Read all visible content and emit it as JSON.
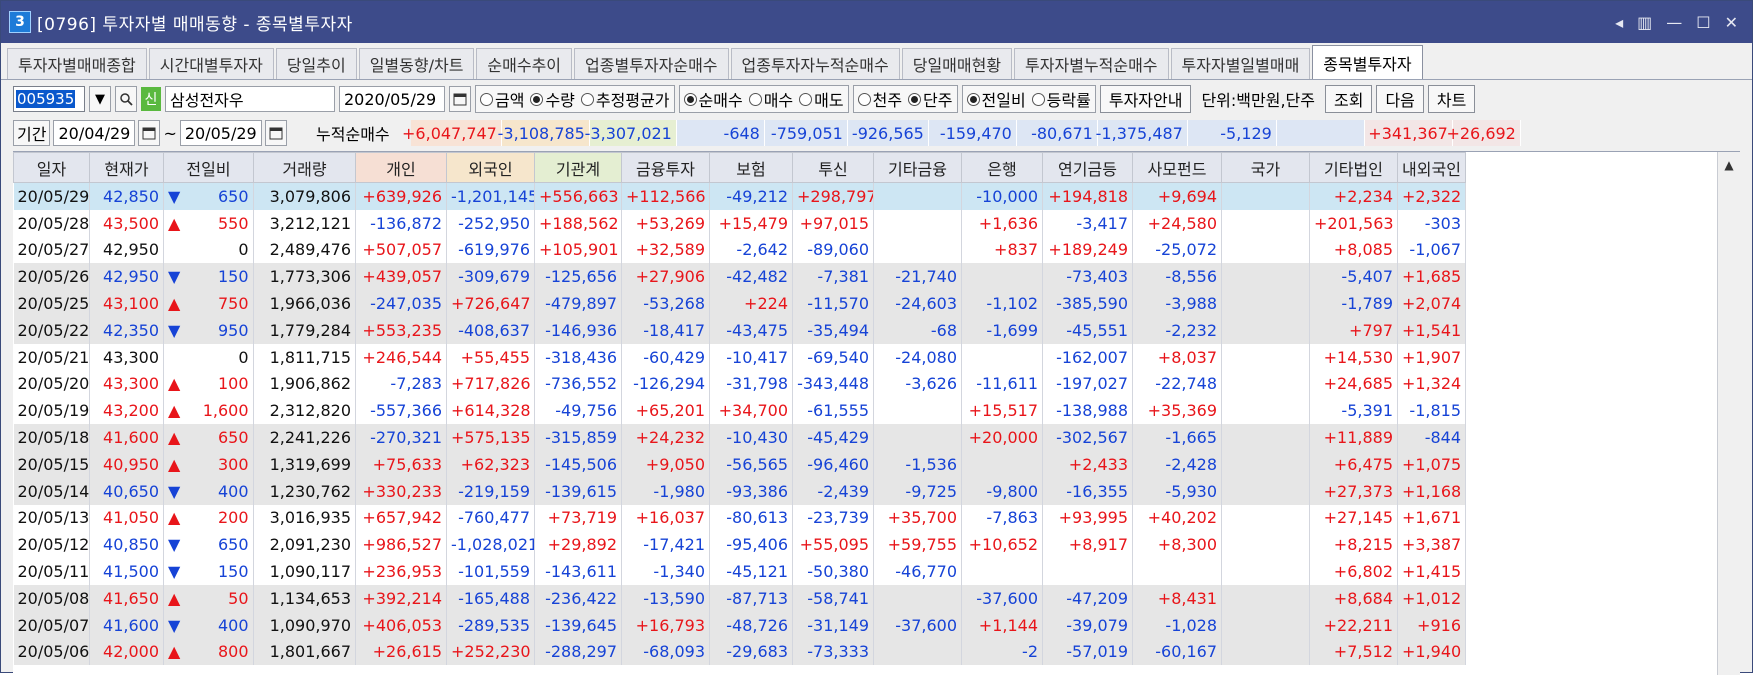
{
  "window": {
    "number": "3",
    "title": "[0796] 투자자별 매매동향 - 종목별투자자",
    "controls": [
      "◂",
      "▥",
      "—",
      "☐",
      "✕"
    ]
  },
  "tabs": [
    {
      "label": "투자자별매매종합",
      "active": false
    },
    {
      "label": "시간대별투자자",
      "active": false
    },
    {
      "label": "당일추이",
      "active": false
    },
    {
      "label": "일별동향/차트",
      "active": false
    },
    {
      "label": "순매수추이",
      "active": false
    },
    {
      "label": "업종별투자자순매수",
      "active": false
    },
    {
      "label": "업종투자자누적순매수",
      "active": false
    },
    {
      "label": "당일매매현황",
      "active": false
    },
    {
      "label": "투자자별누적순매수",
      "active": false
    },
    {
      "label": "투자자별일별매매",
      "active": false
    },
    {
      "label": "종목별투자자",
      "active": true
    }
  ],
  "toolbar": {
    "code": "005935",
    "sin_badge": "신",
    "stock_name": "삼성전자우",
    "date": "2020/05/29",
    "radio_group1": [
      {
        "label": "금액",
        "on": false
      },
      {
        "label": "수량",
        "on": true
      },
      {
        "label": "추정평균가",
        "on": false
      }
    ],
    "radio_group2": [
      {
        "label": "순매수",
        "on": true
      },
      {
        "label": "매수",
        "on": false
      },
      {
        "label": "매도",
        "on": false
      }
    ],
    "radio_group3": [
      {
        "label": "천주",
        "on": false
      },
      {
        "label": "단주",
        "on": true
      }
    ],
    "radio_group4": [
      {
        "label": "전일비",
        "on": true
      },
      {
        "label": "등락률",
        "on": false
      }
    ],
    "guide_button": "투자자안내",
    "unit_text": "단위:백만원,단주",
    "query_button": "조회",
    "next_button": "다음",
    "chart_button": "차트"
  },
  "period": {
    "label": "기간",
    "from": "20/04/29",
    "tilde": "~",
    "to": "20/05/29",
    "cum_label": "누적순매수",
    "sums": [
      {
        "v": "+6,047,747",
        "cls": "red",
        "bg": "#f8e3d6"
      },
      {
        "v": "-3,108,785",
        "cls": "blue",
        "bg": "#f6e6cc"
      },
      {
        "v": "-3,307,021",
        "cls": "blue",
        "bg": "#e6efd2"
      },
      {
        "v": "-648",
        "cls": "blue",
        "bg": "#dde6f4"
      },
      {
        "v": "-759,051",
        "cls": "blue",
        "bg": "#dde6f4"
      },
      {
        "v": "-926,565",
        "cls": "blue",
        "bg": "#dde6f4"
      },
      {
        "v": "-159,470",
        "cls": "blue",
        "bg": "#dde6f4"
      },
      {
        "v": "-80,671",
        "cls": "blue",
        "bg": "#dde6f4"
      },
      {
        "v": "-1,375,487",
        "cls": "blue",
        "bg": "#dde6f4"
      },
      {
        "v": "-5,129",
        "cls": "blue",
        "bg": "#dde6f4"
      },
      {
        "v": "",
        "cls": "blue",
        "bg": "#dde6f4"
      },
      {
        "v": "+341,367",
        "cls": "red",
        "bg": "#f3e6e6"
      },
      {
        "v": "+26,692",
        "cls": "red",
        "bg": "#f3e6e6"
      }
    ]
  },
  "columns": [
    "일자",
    "현재가",
    "전일비",
    "거래량",
    "개인",
    "외국인",
    "기관계",
    "금융투자",
    "보험",
    "투신",
    "기타금융",
    "은행",
    "연기금등",
    "사모펀드",
    "국가",
    "기타법인",
    "내외국인"
  ],
  "header_colors": {
    "개인": "#f6dfd4",
    "외국인": "#f6e6cc",
    "기관계": "#e4eed2"
  },
  "rows": [
    {
      "bg": "sel",
      "cells": [
        "20/05/29",
        "42,850",
        "dn|650",
        "3,079,806",
        "+639,926",
        "-1,201,145",
        "+556,663",
        "+112,566",
        "-49,212",
        "+298,797",
        "",
        "-10,000",
        "+194,818",
        "+9,694",
        "",
        "+2,234",
        "+2,322"
      ]
    },
    {
      "bg": "",
      "cells": [
        "20/05/28",
        "43,500",
        "up|550",
        "3,212,121",
        "-136,872",
        "-252,950",
        "+188,562",
        "+53,269",
        "+15,479",
        "+97,015",
        "",
        "+1,636",
        "-3,417",
        "+24,580",
        "",
        "+201,563",
        "-303"
      ]
    },
    {
      "bg": "",
      "cells": [
        "20/05/27",
        "42,950",
        "|0",
        "2,489,476",
        "+507,057",
        "-619,976",
        "+105,901",
        "+32,589",
        "-2,642",
        "-89,060",
        "",
        "+837",
        "+189,249",
        "-25,072",
        "",
        "+8,085",
        "-1,067"
      ]
    },
    {
      "bg": "g",
      "cells": [
        "20/05/26",
        "42,950",
        "dn|150",
        "1,773,306",
        "+439,057",
        "-309,679",
        "-125,656",
        "+27,906",
        "-42,482",
        "-7,381",
        "-21,740",
        "",
        "-73,403",
        "-8,556",
        "",
        "-5,407",
        "+1,685"
      ]
    },
    {
      "bg": "g",
      "cells": [
        "20/05/25",
        "43,100",
        "up|750",
        "1,966,036",
        "-247,035",
        "+726,647",
        "-479,897",
        "-53,268",
        "+224",
        "-11,570",
        "-24,603",
        "-1,102",
        "-385,590",
        "-3,988",
        "",
        "-1,789",
        "+2,074"
      ]
    },
    {
      "bg": "g",
      "cells": [
        "20/05/22",
        "42,350",
        "dn|950",
        "1,779,284",
        "+553,235",
        "-408,637",
        "-146,936",
        "-18,417",
        "-43,475",
        "-35,494",
        "-68",
        "-1,699",
        "-45,551",
        "-2,232",
        "",
        "+797",
        "+1,541"
      ]
    },
    {
      "bg": "",
      "cells": [
        "20/05/21",
        "43,300",
        "|0",
        "1,811,715",
        "+246,544",
        "+55,455",
        "-318,436",
        "-60,429",
        "-10,417",
        "-69,540",
        "-24,080",
        "",
        "-162,007",
        "+8,037",
        "",
        "+14,530",
        "+1,907"
      ]
    },
    {
      "bg": "",
      "cells": [
        "20/05/20",
        "43,300",
        "up|100",
        "1,906,862",
        "-7,283",
        "+717,826",
        "-736,552",
        "-126,294",
        "-31,798",
        "-343,448",
        "-3,626",
        "-11,611",
        "-197,027",
        "-22,748",
        "",
        "+24,685",
        "+1,324"
      ]
    },
    {
      "bg": "",
      "cells": [
        "20/05/19",
        "43,200",
        "up|1,600",
        "2,312,820",
        "-557,366",
        "+614,328",
        "-49,756",
        "+65,201",
        "+34,700",
        "-61,555",
        "",
        "+15,517",
        "-138,988",
        "+35,369",
        "",
        "-5,391",
        "-1,815"
      ]
    },
    {
      "bg": "g",
      "cells": [
        "20/05/18",
        "41,600",
        "up|650",
        "2,241,226",
        "-270,321",
        "+575,135",
        "-315,859",
        "+24,232",
        "-10,430",
        "-45,429",
        "",
        "+20,000",
        "-302,567",
        "-1,665",
        "",
        "+11,889",
        "-844"
      ]
    },
    {
      "bg": "g",
      "cells": [
        "20/05/15",
        "40,950",
        "up|300",
        "1,319,699",
        "+75,633",
        "+62,323",
        "-145,506",
        "+9,050",
        "-56,565",
        "-96,460",
        "-1,536",
        "",
        "+2,433",
        "-2,428",
        "",
        "+6,475",
        "+1,075"
      ]
    },
    {
      "bg": "g",
      "cells": [
        "20/05/14",
        "40,650",
        "dn|400",
        "1,230,762",
        "+330,233",
        "-219,159",
        "-139,615",
        "-1,980",
        "-93,386",
        "-2,439",
        "-9,725",
        "-9,800",
        "-16,355",
        "-5,930",
        "",
        "+27,373",
        "+1,168"
      ]
    },
    {
      "bg": "",
      "cells": [
        "20/05/13",
        "41,050",
        "up|200",
        "3,016,935",
        "+657,942",
        "-760,477",
        "+73,719",
        "+16,037",
        "-80,613",
        "-23,739",
        "+35,700",
        "-7,863",
        "+93,995",
        "+40,202",
        "",
        "+27,145",
        "+1,671"
      ]
    },
    {
      "bg": "",
      "cells": [
        "20/05/12",
        "40,850",
        "dn|650",
        "2,091,230",
        "+986,527",
        "-1,028,021",
        "+29,892",
        "-17,421",
        "-95,406",
        "+55,095",
        "+59,755",
        "+10,652",
        "+8,917",
        "+8,300",
        "",
        "+8,215",
        "+3,387"
      ]
    },
    {
      "bg": "",
      "cells": [
        "20/05/11",
        "41,500",
        "dn|150",
        "1,090,117",
        "+236,953",
        "-101,559",
        "-143,611",
        "-1,340",
        "-45,121",
        "-50,380",
        "-46,770",
        "",
        "",
        "",
        "",
        "+6,802",
        "+1,415"
      ]
    },
    {
      "bg": "g",
      "cells": [
        "20/05/08",
        "41,650",
        "up|50",
        "1,134,653",
        "+392,214",
        "-165,488",
        "-236,422",
        "-13,590",
        "-87,713",
        "-58,741",
        "",
        "-37,600",
        "-47,209",
        "+8,431",
        "",
        "+8,684",
        "+1,012"
      ]
    },
    {
      "bg": "g",
      "cells": [
        "20/05/07",
        "41,600",
        "dn|400",
        "1,090,970",
        "+406,053",
        "-289,535",
        "-139,645",
        "+16,793",
        "-48,726",
        "-31,149",
        "-37,600",
        "+1,144",
        "-39,079",
        "-1,028",
        "",
        "+22,211",
        "+916"
      ]
    },
    {
      "bg": "g",
      "cells": [
        "20/05/06",
        "42,000",
        "up|800",
        "1,801,667",
        "+26,615",
        "+252,230",
        "-288,297",
        "-68,093",
        "-29,683",
        "-73,333",
        "",
        "-2",
        "-57,019",
        "-60,167",
        "",
        "+7,512",
        "+1,940"
      ]
    }
  ]
}
